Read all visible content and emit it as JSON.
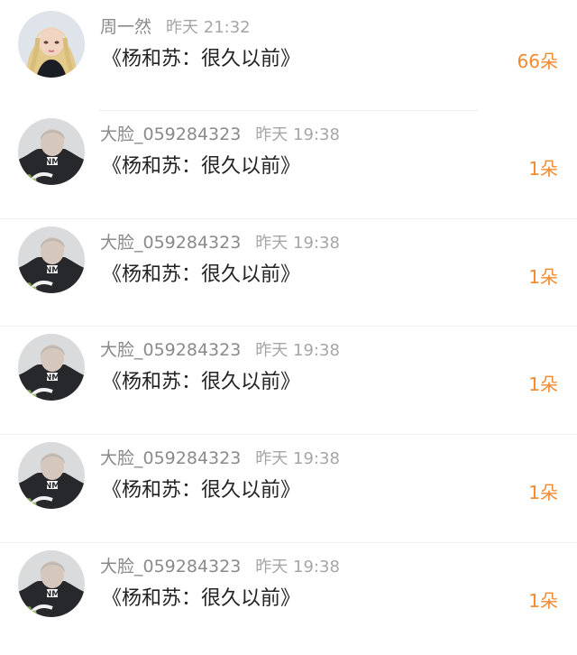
{
  "comments": [
    {
      "avatar": "blonde-woman-avatar",
      "name": "周一然",
      "time": "昨天 21:32",
      "gift": "《杨和苏：很久以前》",
      "count": "66朵"
    },
    {
      "avatar": "man-in-nm-shirt-avatar",
      "name": "大脸_059284323",
      "time": "昨天 19:38",
      "gift": "《杨和苏：很久以前》",
      "count": "1朵"
    },
    {
      "avatar": "man-in-nm-shirt-avatar",
      "name": "大脸_059284323",
      "time": "昨天 19:38",
      "gift": "《杨和苏：很久以前》",
      "count": "1朵"
    },
    {
      "avatar": "man-in-nm-shirt-avatar",
      "name": "大脸_059284323",
      "time": "昨天 19:38",
      "gift": "《杨和苏：很久以前》",
      "count": "1朵"
    },
    {
      "avatar": "man-in-nm-shirt-avatar",
      "name": "大脸_059284323",
      "time": "昨天 19:38",
      "gift": "《杨和苏：很久以前》",
      "count": "1朵"
    },
    {
      "avatar": "man-in-nm-shirt-avatar",
      "name": "大脸_059284323",
      "time": "昨天 19:38",
      "gift": "《杨和苏：很久以前》",
      "count": "1朵"
    }
  ],
  "colors": {
    "accent": "#f28a2f",
    "name": "#8a8a8a",
    "time": "#a6a6a6",
    "text": "#222222"
  }
}
